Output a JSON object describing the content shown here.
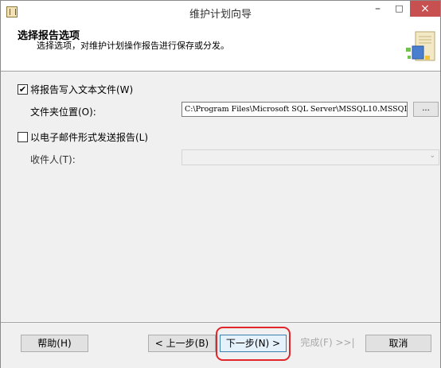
{
  "window": {
    "title": "维护计划向导",
    "minimize": "–",
    "maximize": "□",
    "close": "×"
  },
  "header": {
    "title": "选择报告选项",
    "subtitle": "选择选项，对维护计划操作报告进行保存或分发。"
  },
  "options": {
    "write_to_file": {
      "label": "将报告写入文本文件(W)",
      "checked": true
    },
    "folder_label": "文件夹位置(O):",
    "folder_path": "C:\\Program Files\\Microsoft SQL Server\\MSSQL10.MSSQLS",
    "browse_label": "...",
    "email_report": {
      "label": "以电子邮件形式发送报告(L)",
      "checked": false
    },
    "recipient_label": "收件人(T):",
    "recipient_value": ""
  },
  "footer": {
    "help": "帮助(H)",
    "back": "< 上一步(B)",
    "next": "下一步(N) >",
    "finish": "完成(F) >>|",
    "cancel": "取消"
  },
  "colors": {
    "close_button": "#c75050",
    "highlight": "#e0262b",
    "dialog_bg": "#f0f0f0"
  },
  "icons": {
    "app": "wizard-app-icon",
    "header": "wizard-header-icon",
    "checkbox_checked": "✔"
  }
}
